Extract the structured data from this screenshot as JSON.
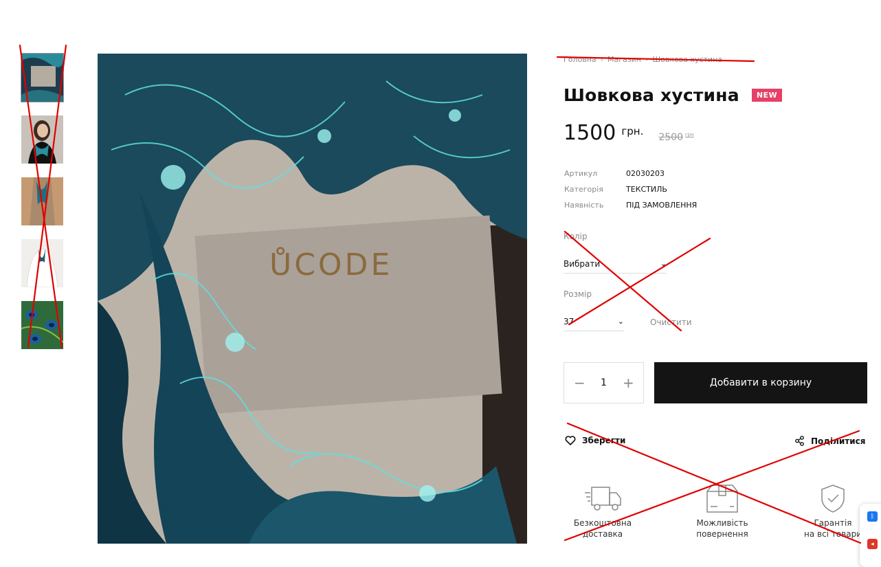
{
  "colors": {
    "accent_badge": "#e64066",
    "button_dark": "#141414",
    "annotation_red": "#e00000",
    "scarf_teal": "#1a4a5c",
    "muted_text": "#8a8a8a"
  },
  "breadcrumb": [
    "Головна",
    "Магазин",
    "Шовкова хустина"
  ],
  "product": {
    "title": "Шовкова хустина",
    "badge": "NEW",
    "price": "1500",
    "currency": "грн.",
    "old_price": "2500",
    "old_currency": "грн",
    "image_brand": "ŮCODE",
    "meta": [
      {
        "label": "Артикул",
        "value": "02030203"
      },
      {
        "label": "Категорія",
        "value": "ТЕКСТИЛЬ"
      },
      {
        "label": "Наявність",
        "value": "ПІД ЗАМОВЛЕННЯ"
      }
    ]
  },
  "options": {
    "color_label": "Колір",
    "color_value": "Вибрати",
    "size_label": "Розмір",
    "size_value": "37",
    "clear_label": "Очистити"
  },
  "cart": {
    "qty_minus": "−",
    "qty_value": "1",
    "qty_plus": "+",
    "add_label": "Добавити в корзину"
  },
  "actions": {
    "save_label": "Зберегти",
    "share_label": "Поділитися"
  },
  "features": [
    {
      "line1": "Безкоштовна",
      "line2": "доставка",
      "icon": "truck-icon"
    },
    {
      "line1": "Можливість",
      "line2": "повернення",
      "icon": "box-icon"
    },
    {
      "line1": "Гарантія",
      "line2": "на всі товари",
      "icon": "shield-check-icon"
    }
  ],
  "thumbnails": [
    "scarf-box",
    "woman-scarf",
    "coat-scarf",
    "white-shirt-scarf",
    "peacock-pattern"
  ],
  "widget": {
    "bluetooth_icon": "bluetooth-icon",
    "speaker_icon": "speaker-icon"
  }
}
